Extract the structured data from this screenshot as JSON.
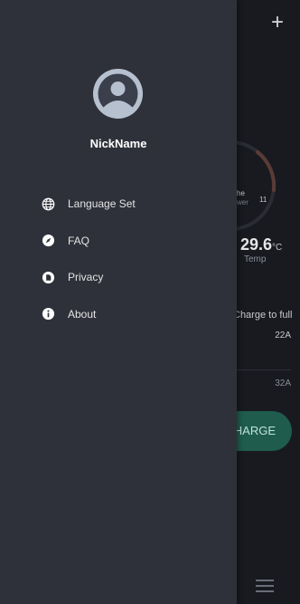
{
  "header": {
    "add_symbol": "+"
  },
  "drawer": {
    "user_name": "NickName",
    "menu": [
      {
        "label": "Language Set",
        "icon": "globe-icon"
      },
      {
        "label": "FAQ",
        "icon": "compass-icon"
      },
      {
        "label": "Privacy",
        "icon": "privacy-icon"
      },
      {
        "label": "About",
        "icon": "info-icon"
      }
    ]
  },
  "background": {
    "temp_value": "29.6",
    "temp_unit": "°C",
    "temp_label": "Temp",
    "charge_to_full_label": "Charge to full",
    "current_value": "22A",
    "current_max": "32A",
    "charge_button_label": "HARGE",
    "gauge_fragment_1": "s",
    "gauge_fragment_2": "he",
    "gauge_fragment_3": "wer",
    "gauge_fragment_4": "11"
  },
  "colors": {
    "drawer_bg": "#2f313a",
    "app_bg": "#181a20",
    "accent": "#1f5c4e"
  }
}
